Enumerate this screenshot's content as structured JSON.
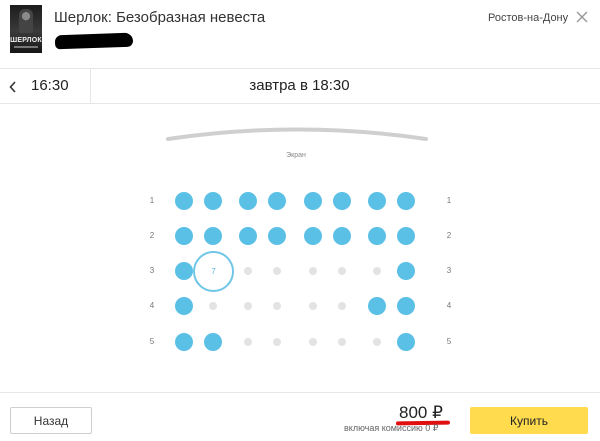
{
  "header": {
    "poster_text": "ШЕРЛОК",
    "movie_title": "Шерлок: Безобразная невеста",
    "city": "Ростов-на-Дону"
  },
  "timebar": {
    "prev_time": "16:30",
    "session": "завтра в 18:30"
  },
  "hall": {
    "screen_label": "Экран",
    "selected_seat_label": "7",
    "rows": [
      {
        "number": "1",
        "seats": [
          "free",
          "free",
          "free",
          "free",
          "free",
          "free",
          "free",
          "free"
        ]
      },
      {
        "number": "2",
        "seats": [
          "free",
          "free",
          "free",
          "free",
          "free",
          "free",
          "free",
          "free"
        ]
      },
      {
        "number": "3",
        "seats": [
          "free",
          "selected",
          "taken",
          "taken",
          "taken",
          "taken",
          "taken",
          "free"
        ]
      },
      {
        "number": "4",
        "seats": [
          "free",
          "taken",
          "taken",
          "taken",
          "taken",
          "taken",
          "free",
          "free"
        ]
      },
      {
        "number": "5",
        "seats": [
          "free",
          "free",
          "taken",
          "taken",
          "taken",
          "taken",
          "taken",
          "free"
        ]
      }
    ]
  },
  "footer": {
    "back_label": "Назад",
    "price": "800 ₽",
    "commission": "включая комиссию 0 ₽",
    "buy_label": "Купить"
  },
  "colors": {
    "seat_free": "#5bc0e6",
    "seat_taken": "#e3e3e3",
    "buy_button": "#ffdb4d",
    "price_underline": "#e01010"
  }
}
